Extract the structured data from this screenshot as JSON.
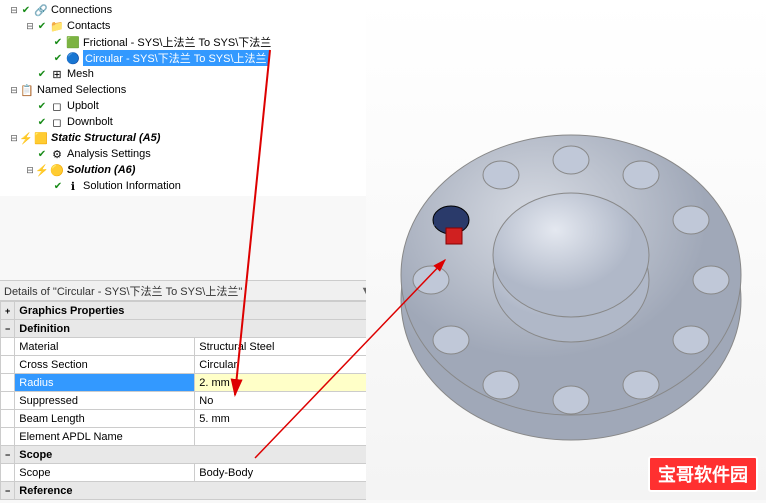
{
  "tree": {
    "connections": "Connections",
    "contacts": "Contacts",
    "frictional": "Frictional - SYS\\上法兰 To SYS\\下法兰",
    "circular": "Circular - SYS\\下法兰 To SYS\\上法兰",
    "mesh": "Mesh",
    "named_selections": "Named Selections",
    "upbolt": "Upbolt",
    "downbolt": "Downbolt",
    "static_structural": "Static Structural (A5)",
    "analysis_settings": "Analysis Settings",
    "solution": "Solution (A6)",
    "solution_info": "Solution Information"
  },
  "details": {
    "title": "Details of \"Circular - SYS\\下法兰 To SYS\\上法兰\"",
    "sections": {
      "graphics": "Graphics Properties",
      "definition": "Definition",
      "scope": "Scope",
      "reference": "Reference"
    },
    "rows": {
      "material": {
        "label": "Material",
        "value": "Structural Steel"
      },
      "cross_section": {
        "label": "Cross Section",
        "value": "Circular"
      },
      "radius": {
        "label": "Radius",
        "value": "2. mm"
      },
      "suppressed": {
        "label": "Suppressed",
        "value": "No"
      },
      "beam_length": {
        "label": "Beam Length",
        "value": "5. mm"
      },
      "element_apdl": {
        "label": "Element APDL Name",
        "value": ""
      },
      "scope_val": {
        "label": "Scope",
        "value": "Body-Body"
      }
    }
  },
  "watermark": "宝哥软件园"
}
